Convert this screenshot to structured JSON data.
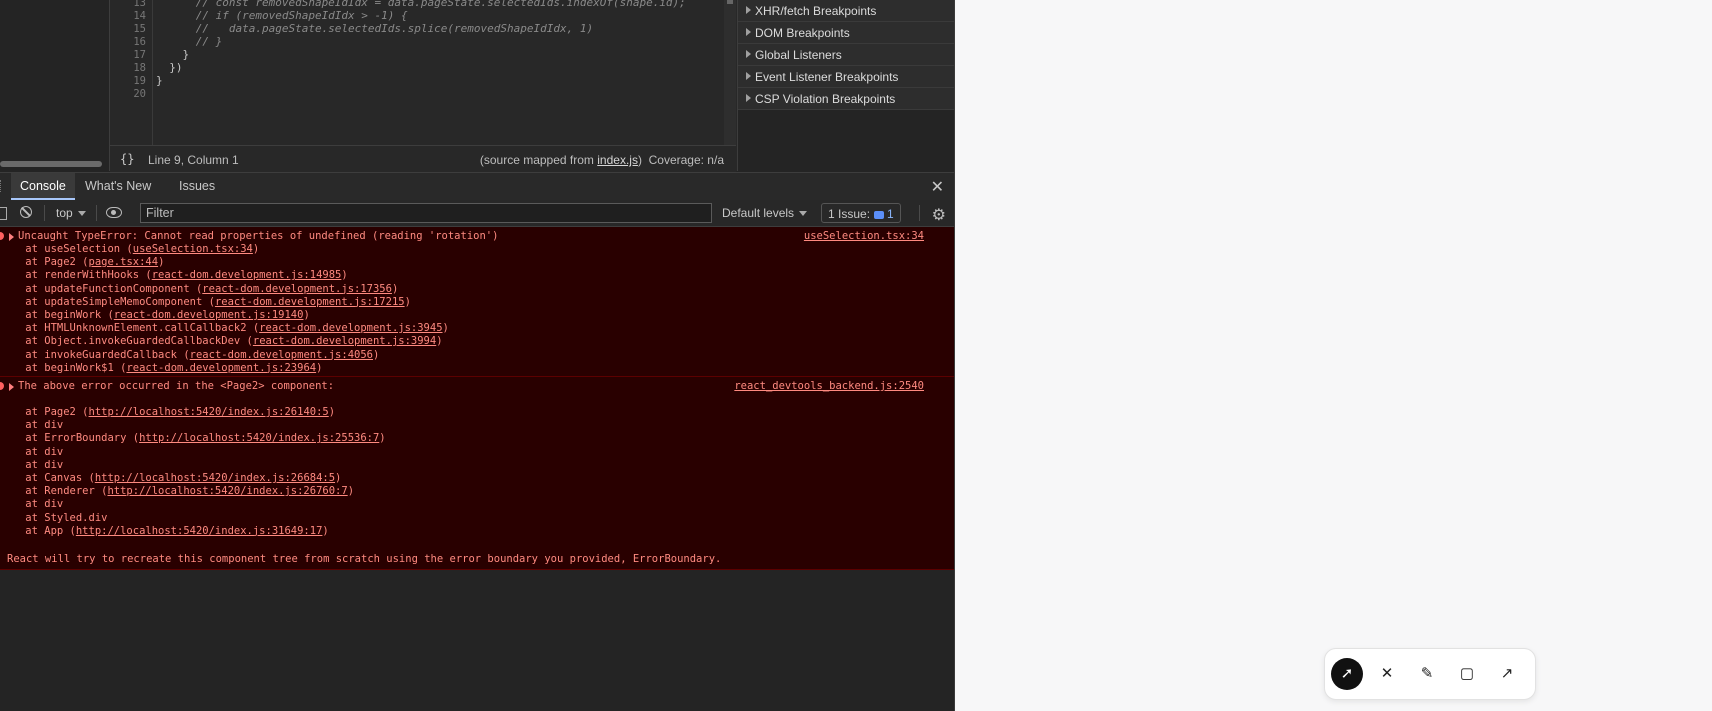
{
  "editor": {
    "lines": [
      {
        "num": "13",
        "text": "      // const removedShapeIdIdx = data.pageState.selectedIds.indexOf(shape.id);",
        "comment": true
      },
      {
        "num": "14",
        "text": "      // if (removedShapeIdIdx > -1) {",
        "comment": true
      },
      {
        "num": "15",
        "text": "      //   data.pageState.selectedIds.splice(removedShapeIdIdx, 1)",
        "comment": true
      },
      {
        "num": "16",
        "text": "      // }",
        "comment": true
      },
      {
        "num": "17",
        "text": "    }",
        "comment": false
      },
      {
        "num": "18",
        "text": "  })",
        "comment": false
      },
      {
        "num": "19",
        "text": "}",
        "comment": false
      },
      {
        "num": "20",
        "text": "",
        "comment": false
      }
    ],
    "status": {
      "braces": "{}",
      "position": "Line 9, Column 1",
      "source_prefix": "(source mapped from ",
      "source_file": "index.js",
      "source_suffix": ")",
      "coverage": "Coverage: n/a"
    }
  },
  "breakpoints": [
    "XHR/fetch Breakpoints",
    "DOM Breakpoints",
    "Global Listeners",
    "Event Listener Breakpoints",
    "CSP Violation Breakpoints"
  ],
  "drawer": {
    "tabs": [
      "Console",
      "What's New",
      "Issues"
    ],
    "active_tab": "Console"
  },
  "console_toolbar": {
    "context": "top",
    "filter_placeholder": "Filter",
    "levels": "Default levels",
    "issues_label": "1 Issue:",
    "issues_count": "1"
  },
  "messages": {
    "error1": {
      "message": "Uncaught TypeError: Cannot read properties of undefined (reading 'rotation')",
      "source": "useSelection.tsx:34",
      "stack": [
        {
          "prefix": "    at useSelection (",
          "link": "useSelection.tsx:34",
          "suffix": ")"
        },
        {
          "prefix": "    at Page2 (",
          "link": "page.tsx:44",
          "suffix": ")"
        },
        {
          "prefix": "    at renderWithHooks (",
          "link": "react-dom.development.js:14985",
          "suffix": ")"
        },
        {
          "prefix": "    at updateFunctionComponent (",
          "link": "react-dom.development.js:17356",
          "suffix": ")"
        },
        {
          "prefix": "    at updateSimpleMemoComponent (",
          "link": "react-dom.development.js:17215",
          "suffix": ")"
        },
        {
          "prefix": "    at beginWork (",
          "link": "react-dom.development.js:19140",
          "suffix": ")"
        },
        {
          "prefix": "    at HTMLUnknownElement.callCallback2 (",
          "link": "react-dom.development.js:3945",
          "suffix": ")"
        },
        {
          "prefix": "    at Object.invokeGuardedCallbackDev (",
          "link": "react-dom.development.js:3994",
          "suffix": ")"
        },
        {
          "prefix": "    at invokeGuardedCallback (",
          "link": "react-dom.development.js:4056",
          "suffix": ")"
        },
        {
          "prefix": "    at beginWork$1 (",
          "link": "react-dom.development.js:23964",
          "suffix": ")"
        }
      ]
    },
    "error2": {
      "message": "The above error occurred in the <Page2> component:",
      "source": "react_devtools_backend.js:2540",
      "stack": [
        {
          "prefix": "    at Page2 (",
          "link": "http://localhost:5420/index.js:26140:5",
          "suffix": ")"
        },
        {
          "prefix": "    at div",
          "link": "",
          "suffix": ""
        },
        {
          "prefix": "    at ErrorBoundary (",
          "link": "http://localhost:5420/index.js:25536:7",
          "suffix": ")"
        },
        {
          "prefix": "    at div",
          "link": "",
          "suffix": ""
        },
        {
          "prefix": "    at div",
          "link": "",
          "suffix": ""
        },
        {
          "prefix": "    at Canvas (",
          "link": "http://localhost:5420/index.js:26684:5",
          "suffix": ")"
        },
        {
          "prefix": "    at Renderer (",
          "link": "http://localhost:5420/index.js:26760:7",
          "suffix": ")"
        },
        {
          "prefix": "    at div",
          "link": "",
          "suffix": ""
        },
        {
          "prefix": "    at Styled.div",
          "link": "",
          "suffix": ""
        },
        {
          "prefix": "    at App (",
          "link": "http://localhost:5420/index.js:31649:17",
          "suffix": ")"
        }
      ],
      "footer": "React will try to recreate this component tree from scratch using the error boundary you provided, ErrorBoundary."
    }
  },
  "draw_toolbar": {
    "tools": [
      {
        "name": "select-tool",
        "icon": "cursor-icon",
        "glyph": "➚",
        "active": true
      },
      {
        "name": "erase-tool",
        "icon": "close-icon",
        "glyph": "✕",
        "active": false
      },
      {
        "name": "draw-tool",
        "icon": "pencil-icon",
        "glyph": "✎",
        "active": false
      },
      {
        "name": "rectangle-tool",
        "icon": "square-icon",
        "glyph": "▢",
        "active": false
      },
      {
        "name": "arrow-tool",
        "icon": "arrow-up-right-icon",
        "glyph": "↗",
        "active": false
      }
    ]
  }
}
